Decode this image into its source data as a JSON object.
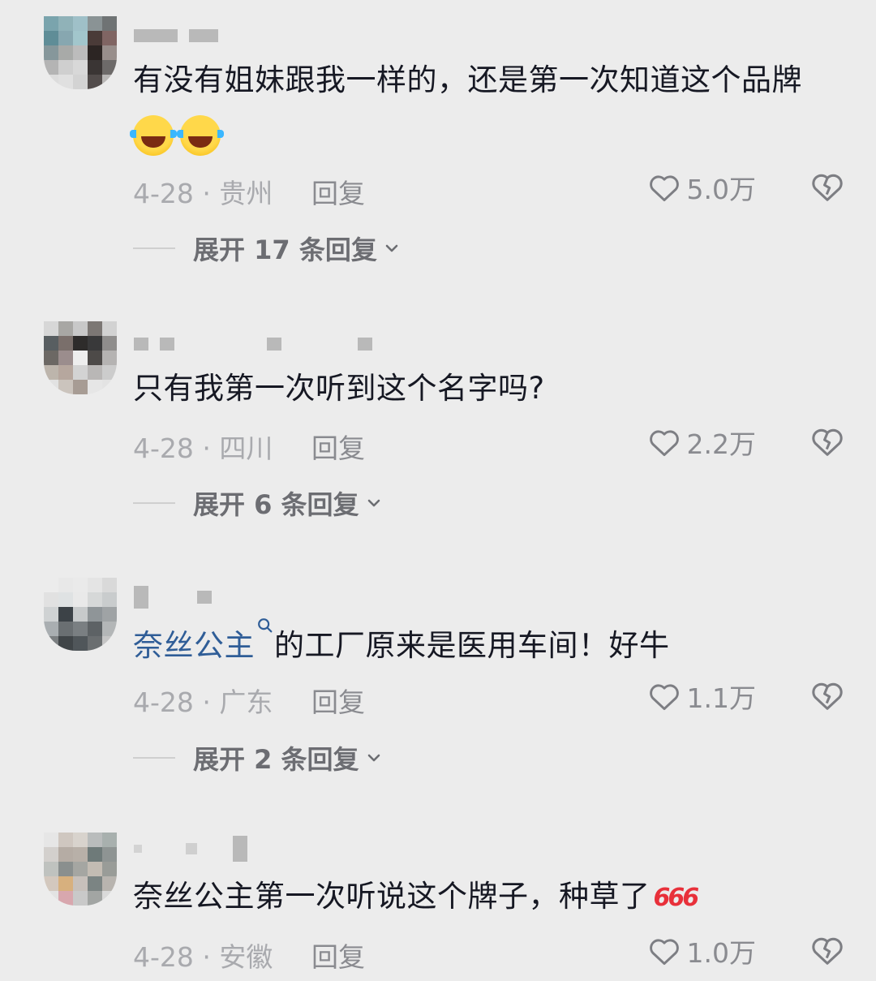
{
  "comments": [
    {
      "text_before": "有没有姐妹跟我一样的，还是第一次知道这个品牌",
      "emoji": [
        "cry-laugh-emoji",
        "cry-laugh-emoji"
      ],
      "date_location": "4-28 · 贵州",
      "reply_label": "回复",
      "likes": "5.0万",
      "expand_label": "展开 17 条回复"
    },
    {
      "text_before": "只有我第一次听到这个名字吗?",
      "date_location": "4-28 · 四川",
      "reply_label": "回复",
      "likes": "2.2万",
      "expand_label": "展开 6 条回复"
    },
    {
      "mention": "奈丝公主",
      "text_after": "的工厂原来是医用车间！好牛",
      "date_location": "4-28 · 广东",
      "reply_label": "回复",
      "likes": "1.1万",
      "expand_label": "展开 2 条回复"
    },
    {
      "text_before": "奈丝公主第一次听说这个牌子，种草了",
      "sticker": "666",
      "date_location": "4-28 · 安徽",
      "reply_label": "回复",
      "likes": "1.0万"
    }
  ],
  "icons": {
    "like": "heart-outline-icon",
    "dislike": "broken-heart-icon",
    "expand": "chevron-down-icon",
    "mention": "search-icon"
  },
  "colors": {
    "background": "#ececec",
    "text": "#161823",
    "meta": "#a9aaae",
    "mention": "#2f5d97"
  }
}
